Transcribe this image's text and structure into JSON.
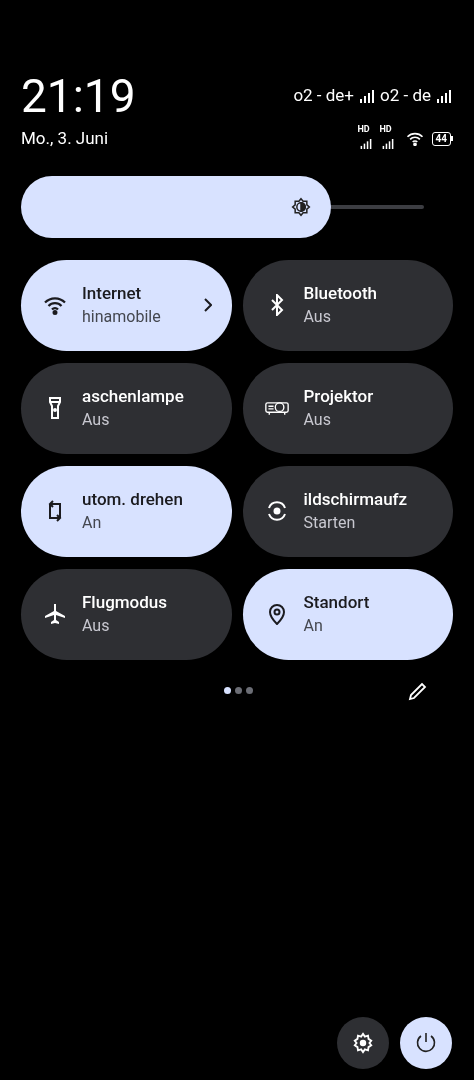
{
  "header": {
    "time": "21:19",
    "date": "Mo., 3. Juni",
    "carriers": [
      "o2 - de+",
      "o2 - de"
    ],
    "hd_labels": [
      "HD",
      "HD"
    ],
    "battery": "44"
  },
  "brightness": {
    "level": 0.77
  },
  "tiles": [
    {
      "kind": "wifi",
      "label": "Internet",
      "status": "hinamobile",
      "on": true,
      "chevron": true
    },
    {
      "kind": "bluetooth",
      "label": "Bluetooth",
      "status": "Aus",
      "on": false,
      "chevron": false
    },
    {
      "kind": "flashlight",
      "label": "aschenlampe",
      "status": "Aus",
      "on": false,
      "chevron": false
    },
    {
      "kind": "projector",
      "label": "Projektor",
      "status": "Aus",
      "on": false,
      "chevron": false
    },
    {
      "kind": "rotate",
      "label": "utom. drehen",
      "status": "An",
      "on": true,
      "chevron": false
    },
    {
      "kind": "record",
      "label": "ildschirmaufz",
      "status": "Starten",
      "on": false,
      "chevron": false
    },
    {
      "kind": "plane",
      "label": "Flugmodus",
      "status": "Aus",
      "on": false,
      "chevron": false
    },
    {
      "kind": "pin",
      "label": "Standort",
      "status": "An",
      "on": true,
      "chevron": false
    }
  ],
  "pages": [
    {
      "selected": true
    },
    {
      "selected": false
    },
    {
      "selected": false
    }
  ]
}
